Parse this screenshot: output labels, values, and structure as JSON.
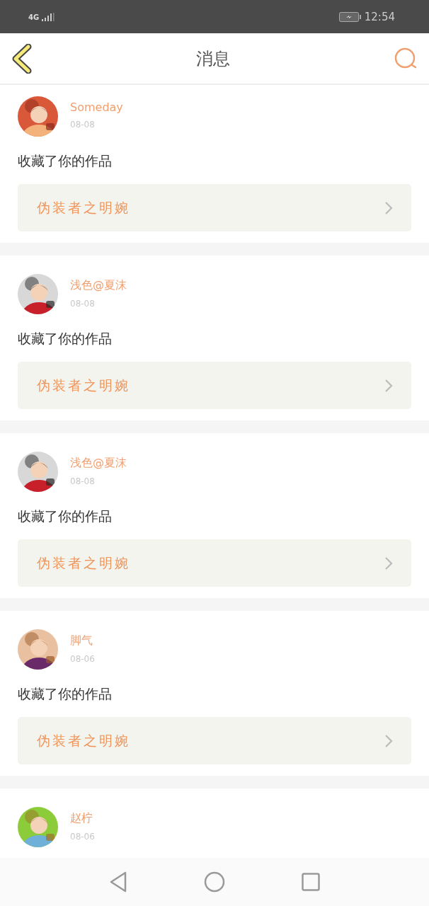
{
  "status_bar": {
    "network": "4G",
    "time": "12:54"
  },
  "header": {
    "title": "消息"
  },
  "messages": [
    {
      "user": "Someday",
      "date": "08-08",
      "action": "收藏了你的作品",
      "work": "伪装者之明婉"
    },
    {
      "user": "浅色@夏沫",
      "date": "08-08",
      "action": "收藏了你的作品",
      "work": "伪装者之明婉"
    },
    {
      "user": "浅色@夏沫",
      "date": "08-08",
      "action": "收藏了你的作品",
      "work": "伪装者之明婉"
    },
    {
      "user": "脚气",
      "date": "08-06",
      "action": "收藏了你的作品",
      "work": "伪装者之明婉"
    },
    {
      "user": "赵柠",
      "date": "08-06"
    }
  ]
}
